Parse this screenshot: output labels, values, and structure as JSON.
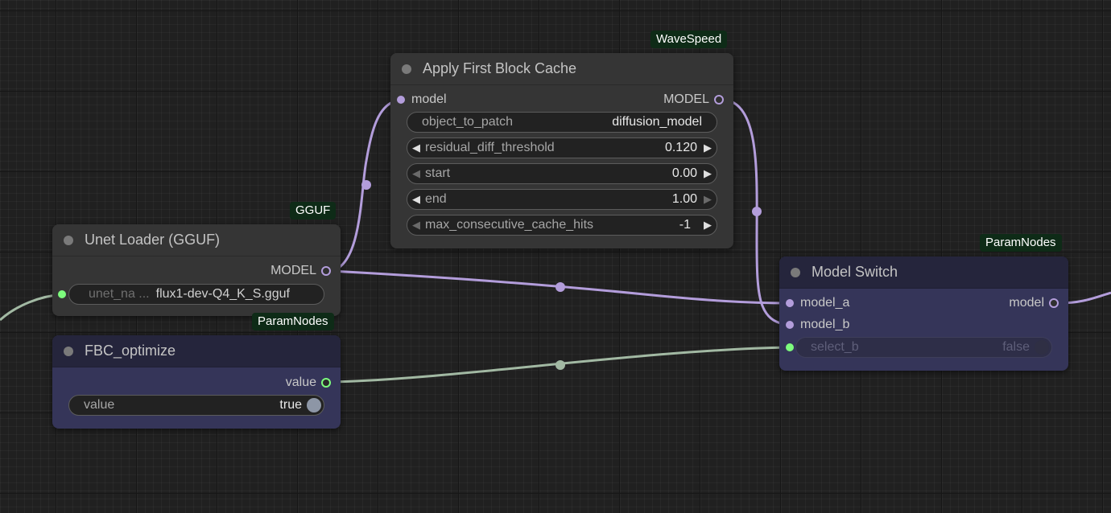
{
  "nodes": {
    "unet_loader": {
      "badge": "GGUF",
      "title": "Unet Loader (GGUF)",
      "output_label": "MODEL",
      "widget_label": "unet_na ...",
      "widget_value": "flux1-dev-Q4_K_S.gguf"
    },
    "fbc_optimize": {
      "badge": "ParamNodes",
      "title": "FBC_optimize",
      "output_label": "value",
      "widget_label": "value",
      "widget_value": "true"
    },
    "apply_fbc": {
      "badge": "WaveSpeed",
      "title": "Apply First Block Cache",
      "input_label": "model",
      "output_label": "MODEL",
      "widgets": [
        {
          "label": "object_to_patch",
          "value": "diffusion_model"
        },
        {
          "label": "residual_diff_threshold",
          "value": "0.120"
        },
        {
          "label": "start",
          "value": "0.00"
        },
        {
          "label": "end",
          "value": "1.00"
        },
        {
          "label": "max_consecutive_cache_hits",
          "value": "-1"
        }
      ]
    },
    "model_switch": {
      "badge": "ParamNodes",
      "title": "Model Switch",
      "inputs": [
        "model_a",
        "model_b"
      ],
      "output_label": "model",
      "widget_label": "select_b",
      "widget_value": "false"
    }
  },
  "colors": {
    "model_link": "#b39ddb",
    "bool_link": "#a2b9a3",
    "badge_bg": "#0e2b17",
    "node_bg": "#353535",
    "param_node_bg": "#353559"
  },
  "icons": {
    "decrement": "left-triangle-icon",
    "increment": "right-triangle-icon"
  }
}
